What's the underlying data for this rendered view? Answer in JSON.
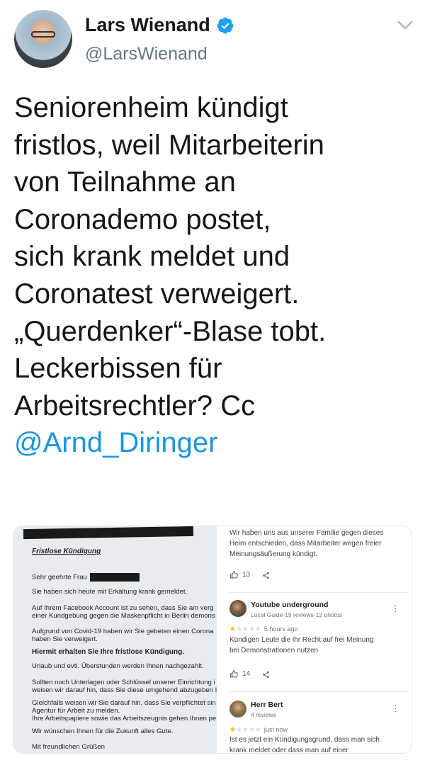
{
  "tweet": {
    "author_name": "Lars Wienand",
    "author_handle": "@LarsWienand",
    "text_lines": [
      "Seniorenheim kündigt",
      "fristlos, weil Mitarbeiterin",
      "von Teilnahme an",
      "Coronademo postet,",
      "sich krank meldet und",
      "Coronatest verweigert.",
      "„Querdenker“-Blase tobt.",
      "Leckerbissen für",
      "Arbeitsrechtler? Cc"
    ],
    "mention": "@Arnd_Diringer"
  },
  "icons": {
    "verified": "verified-badge-icon",
    "menu": "chevron-down-icon",
    "like": "thumbs-up-icon",
    "share": "share-icon",
    "more": "more-vertical-icon"
  },
  "colors": {
    "mention": "#1b95e0",
    "verified": "#1da1f2",
    "handle": "#657786",
    "star": "#fbbc04"
  },
  "media": {
    "letter": {
      "heading": "Fristlose Kündigung",
      "salutation": "Sehr geehrte Frau",
      "lines": [
        "Sie haben sich heute mit Erkältung krank gemeldet.",
        "Auf Ihrem Facebook Account ist zu sehen, dass Sie am verg",
        "einer Kundgebung gegen die Maskenpflicht in Berlin demons",
        "Aufgrund von Covid-19 haben wir Sie gebeten einen Corona",
        "haben Sie verweigert.",
        "Hiermit erhalten Sie Ihre fristlose Kündigung.",
        "Urlaub und evtl. Überstunden werden Ihnen nachgezahlt.",
        "Sollten noch Unterlagen oder Schlüssel unserer Einrichtung i",
        "weisen wir darauf hin, dass Sie diese umgehend abzugeben I",
        "Gleichfalls weisen wir Sie darauf hin, dass Sie verpflichtet sin",
        "Agentur für Arbeit zu melden.",
        "Ihre Arbeitspapiere sowie das Arbeitszeugnis gehen Ihnen pe",
        "Wir wünschen Ihnen für die Zukunft alles Gute.",
        "Mit freundlichen Grüßen"
      ]
    },
    "reviews": {
      "top_text_lines": [
        "Wir haben uns aus unserer Familie gegen dieses",
        "Heim entschieden, dass Mitarbeiter wegen freier",
        "Meinungsäußerung kündigt."
      ],
      "top_likes": "13",
      "items": [
        {
          "name": "Youtube underground",
          "meta": "Local Guide·19 reviews·12 photos",
          "rating": 1,
          "time": "5 hours ago",
          "text_lines": [
            "Kündigen Leute die ihr Recht auf frei Meinung",
            "bei Demonstrationen nutzen"
          ],
          "likes": "14"
        },
        {
          "name": "Herr Bert",
          "meta": "4 reviews",
          "rating": 1,
          "time": "just now",
          "text_lines": [
            "Ist es jetzt ein Kündigungsgrund, dass man sich",
            "krank meldet oder dass man auf einer"
          ]
        }
      ]
    }
  }
}
